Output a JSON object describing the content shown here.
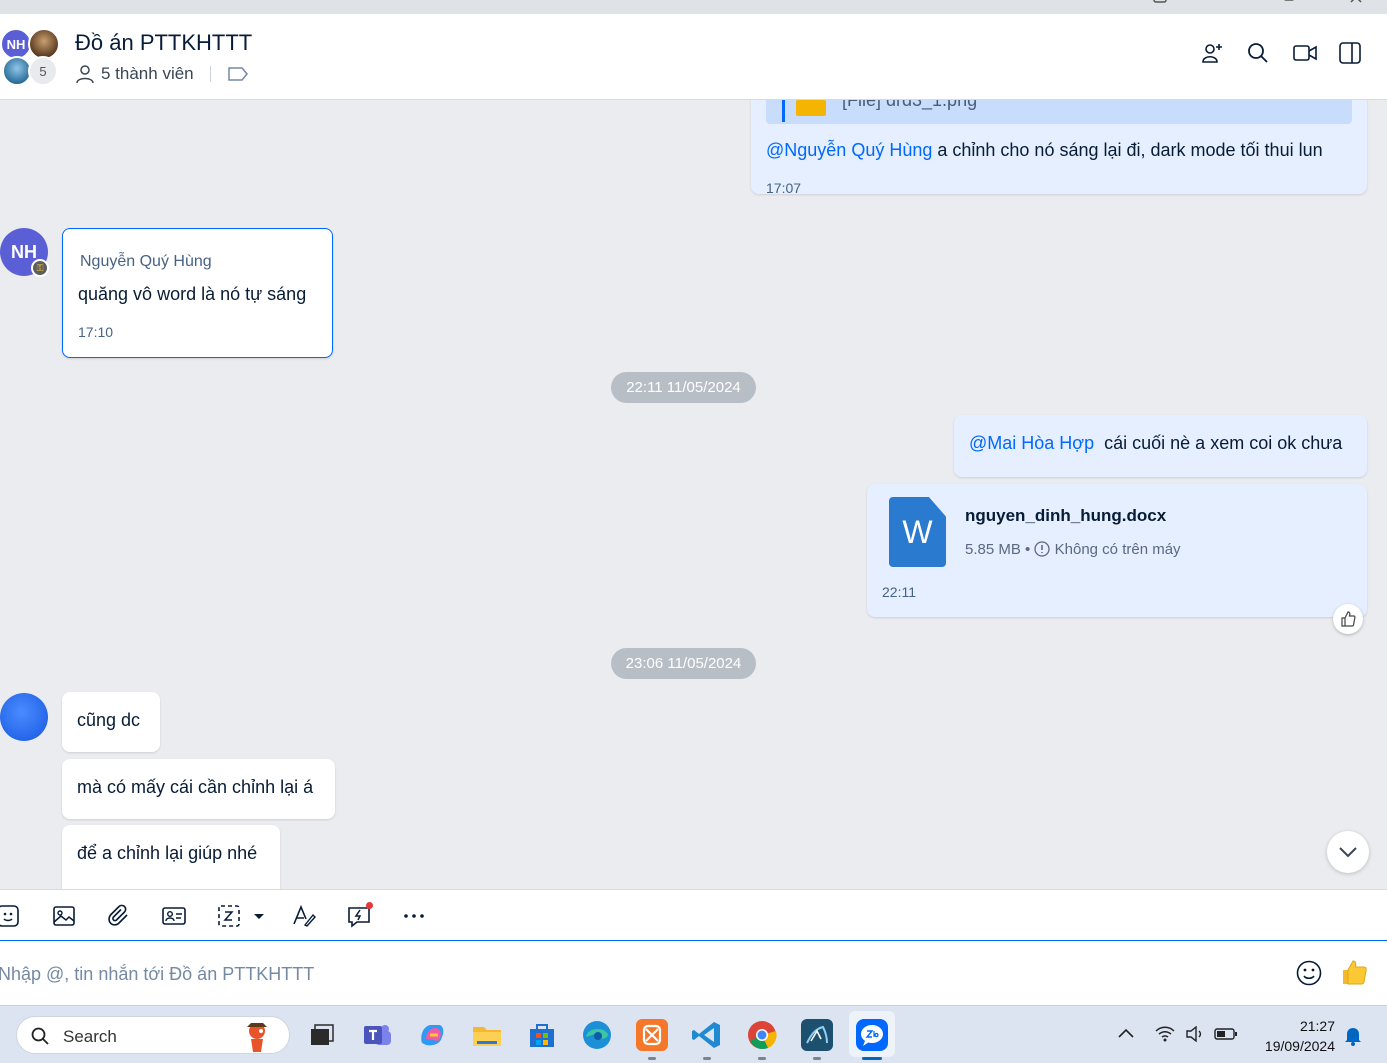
{
  "window": {
    "minimize_icon": "minimize-icon",
    "restore_icon": "restore-icon",
    "close_icon": "close-icon"
  },
  "header": {
    "avatar_initials": "NH",
    "extra_members_count": "5",
    "title": "Đồ án PTTKHTTT",
    "members_label": "5 thành viên",
    "icons": [
      "add-member-icon",
      "search-icon",
      "video-call-icon",
      "sidebar-toggle-icon"
    ]
  },
  "messages": {
    "top": {
      "reply_text": "[File] drd3_1.png",
      "mention": "@Nguyễn Quý Hùng",
      "text": " a chỉnh cho nó sáng lại đi, dark mode tối thui lun",
      "time": "17:07"
    },
    "nh": {
      "avatar_initials": "NH",
      "sender": "Nguyễn Quý Hùng",
      "text": "quăng vô word là nó tự sáng",
      "time": "17:10"
    },
    "date1": "22:11 11/05/2024",
    "hop": {
      "mention": "@Mai Hòa Hợp",
      "text": "  cái cuối nè a xem coi ok chưa"
    },
    "file": {
      "icon_letter": "W",
      "name": "nguyen_dinh_hung.docx",
      "size": "5.85 MB",
      "status": "Không có trên máy",
      "time": "22:11"
    },
    "date2": "23:06 11/05/2024",
    "a": "cũng dc",
    "b": "mà có mấy cái cần chỉnh lại á",
    "c": "để a chỉnh lại giúp nhé"
  },
  "composer": {
    "placeholder": "Nhập @, tin nhắn tới Đồ án PTTKHTTT",
    "toolbar_icons": [
      "sticker-icon",
      "image-icon",
      "attach-icon",
      "contact-card-icon",
      "screenshot-icon",
      "format-text-icon",
      "quick-message-icon",
      "more-icon"
    ]
  },
  "taskbar": {
    "search_label": "Search",
    "apps": [
      "task-view-icon",
      "teams-icon",
      "copilot-icon",
      "file-explorer-icon",
      "store-icon",
      "edge-icon",
      "xampp-icon",
      "vscode-icon",
      "chrome-icon",
      "mysql-workbench-icon",
      "zalo-icon"
    ],
    "time": "21:27",
    "date": "19/09/2024"
  },
  "colors": {
    "accent": "#0068ff",
    "my_bubble": "#e5efff",
    "chat_bg": "#ebecf0"
  }
}
